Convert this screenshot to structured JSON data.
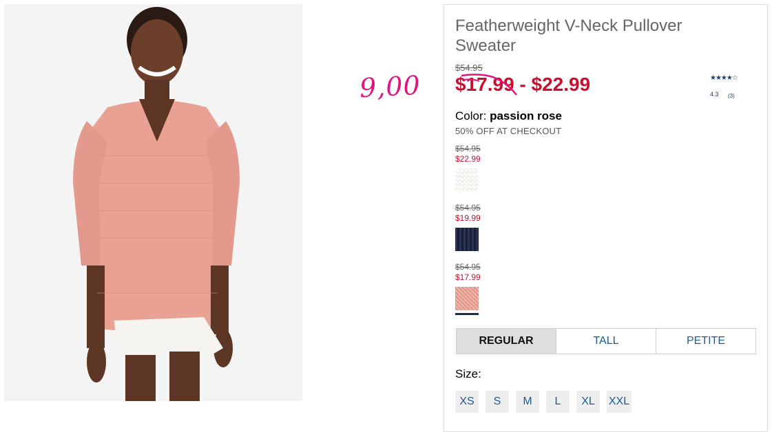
{
  "product": {
    "title": "Featherweight V-Neck Pullover Sweater",
    "original_price": "$54.95",
    "sale_price_low": "$17.99",
    "sale_price_separator": "-",
    "sale_price_high": "$22.99",
    "rating": {
      "stars_text": "★★★★☆",
      "value": "4.3",
      "count": "(3)"
    }
  },
  "annotation": {
    "handwritten_price": "9,00"
  },
  "color": {
    "label": "Color:",
    "selected_name": "passion rose",
    "promo_text": "50% OFF AT CHECKOUT"
  },
  "swatches": [
    {
      "original_price": "$54.95",
      "sale_price": "$22.99",
      "color_name": "white",
      "color": "#f1f0ea"
    },
    {
      "original_price": "$54.95",
      "sale_price": "$19.99",
      "color_name": "navy",
      "color": "#1b2341"
    },
    {
      "original_price": "$54.95",
      "sale_price": "$17.99",
      "color_name": "passion rose",
      "color": "#e8a296",
      "selected": true
    }
  ],
  "fit_tabs": [
    {
      "label": "REGULAR",
      "active": true
    },
    {
      "label": "TALL",
      "active": false
    },
    {
      "label": "PETITE",
      "active": false
    }
  ],
  "size": {
    "label": "Size:",
    "options": [
      "XS",
      "S",
      "M",
      "L",
      "XL",
      "XXL"
    ]
  },
  "colors": {
    "sale_red": "#c8102e",
    "link_blue": "#1a5a96",
    "annotation_pink": "#e0157e",
    "rating_navy": "#1a3c6e"
  }
}
